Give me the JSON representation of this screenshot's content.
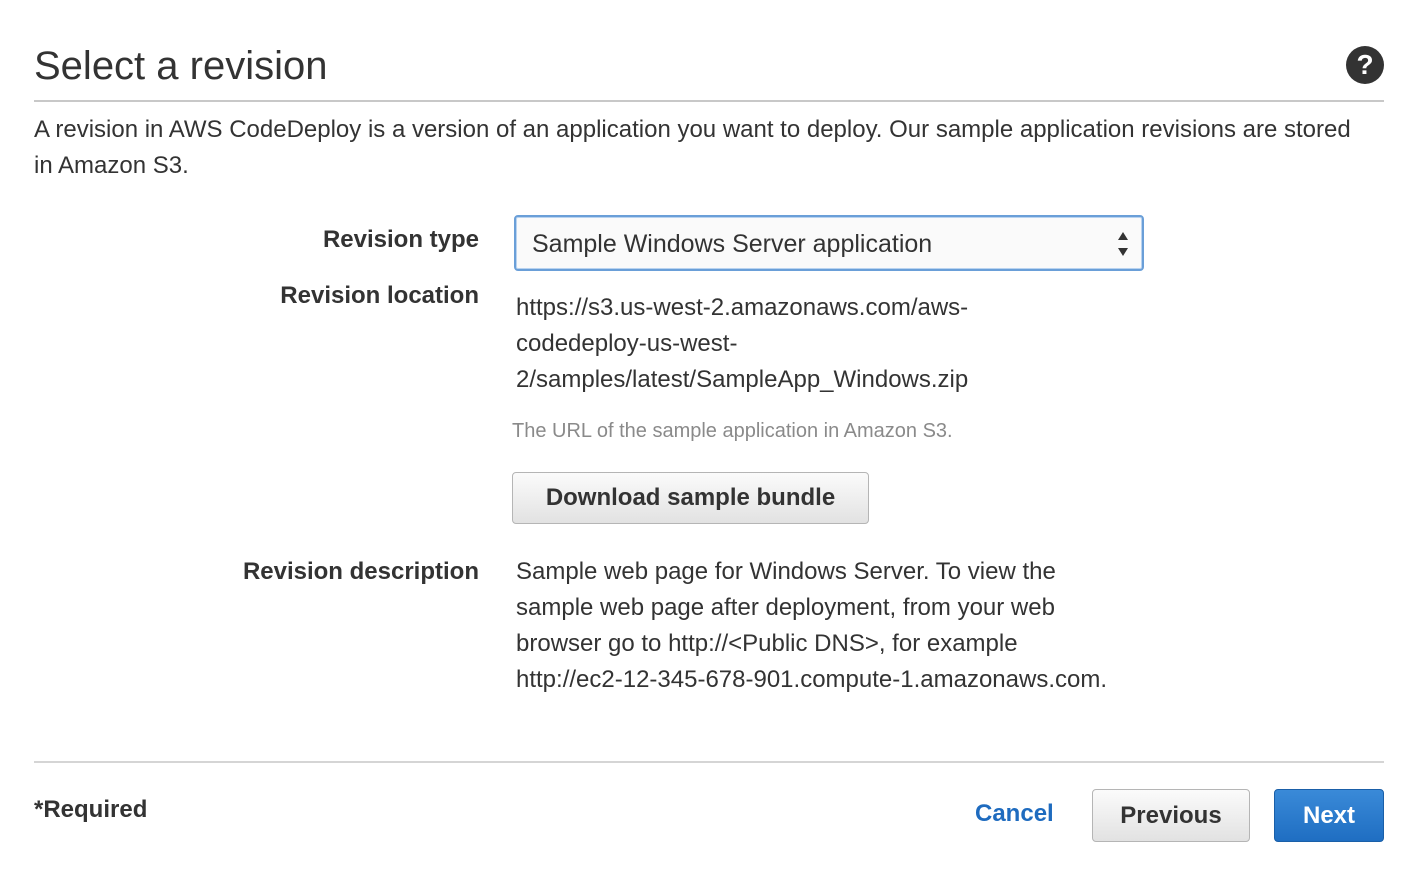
{
  "header": {
    "title": "Select a revision",
    "help_icon": "question-circle-icon"
  },
  "intro": "A revision in AWS CodeDeploy is a version of an application you want to deploy. Our sample application revisions are stored in Amazon S3.",
  "form": {
    "revision_type": {
      "label": "Revision type",
      "selected": "Sample Windows Server application"
    },
    "revision_location": {
      "label": "Revision location",
      "value": "https://s3.us-west-2.amazonaws.com/aws-codedeploy-us-west-2/samples/latest/SampleApp_Windows.zip",
      "hint": "The URL of the sample application in Amazon S3.",
      "download_label": "Download sample bundle"
    },
    "revision_description": {
      "label": "Revision description",
      "value": "Sample web page for Windows Server. To view the sample web page after deployment, from your web browser go to http://<Public DNS>, for example http://ec2-12-345-678-901.compute-1.amazonaws.com."
    }
  },
  "footer": {
    "required_note": "*Required",
    "cancel_label": "Cancel",
    "previous_label": "Previous",
    "next_label": "Next"
  },
  "colors": {
    "accent": "#1e6bbf",
    "primary_button": "#2a7bcf",
    "focus_border": "#6a9fd8",
    "hint_text": "#8a8a8a"
  }
}
